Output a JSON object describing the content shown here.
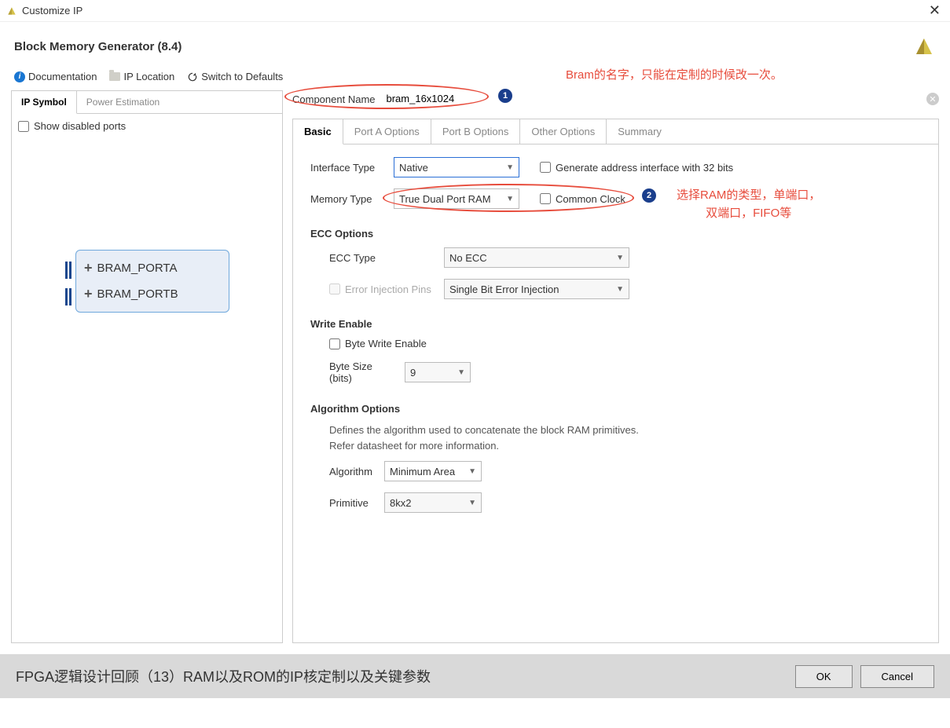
{
  "titlebar": {
    "title": "Customize IP"
  },
  "header": {
    "title": "Block Memory Generator (8.4)"
  },
  "toolbar": {
    "documentation": "Documentation",
    "ip_location": "IP Location",
    "switch_defaults": "Switch to Defaults"
  },
  "annotations": {
    "bram_name": "Bram的名字，只能在定制的时候改一次。",
    "ram_type_l1": "选择RAM的类型，单端口，",
    "ram_type_l2": "双端口，FIFO等"
  },
  "left": {
    "tabs": [
      "IP Symbol",
      "Power Estimation"
    ],
    "show_disabled_ports": "Show disabled ports",
    "ports": [
      "BRAM_PORTA",
      "BRAM_PORTB"
    ]
  },
  "compname": {
    "label": "Component Name",
    "value": "bram_16x1024"
  },
  "righttabs": [
    "Basic",
    "Port A Options",
    "Port B Options",
    "Other Options",
    "Summary"
  ],
  "basic": {
    "interface_type_label": "Interface Type",
    "interface_type": "Native",
    "generate_32": "Generate address interface with 32 bits",
    "memory_type_label": "Memory Type",
    "memory_type": "True Dual Port RAM",
    "common_clock": "Common Clock",
    "ecc_title": "ECC Options",
    "ecc_type_label": "ECC Type",
    "ecc_type": "No ECC",
    "err_inj_label": "Error Injection Pins",
    "err_inj": "Single Bit Error Injection",
    "write_enable_title": "Write Enable",
    "byte_write_enable": "Byte Write Enable",
    "byte_size_label": "Byte Size (bits)",
    "byte_size": "9",
    "algo_title": "Algorithm Options",
    "algo_help1": "Defines the algorithm used to concatenate the block RAM primitives.",
    "algo_help2": "Refer datasheet for more information.",
    "algorithm_label": "Algorithm",
    "algorithm": "Minimum Area",
    "primitive_label": "Primitive",
    "primitive": "8kx2"
  },
  "footer": {
    "caption": "FPGA逻辑设计回顾（13）RAM以及ROM的IP核定制以及关键参数",
    "ok": "OK",
    "cancel": "Cancel"
  }
}
